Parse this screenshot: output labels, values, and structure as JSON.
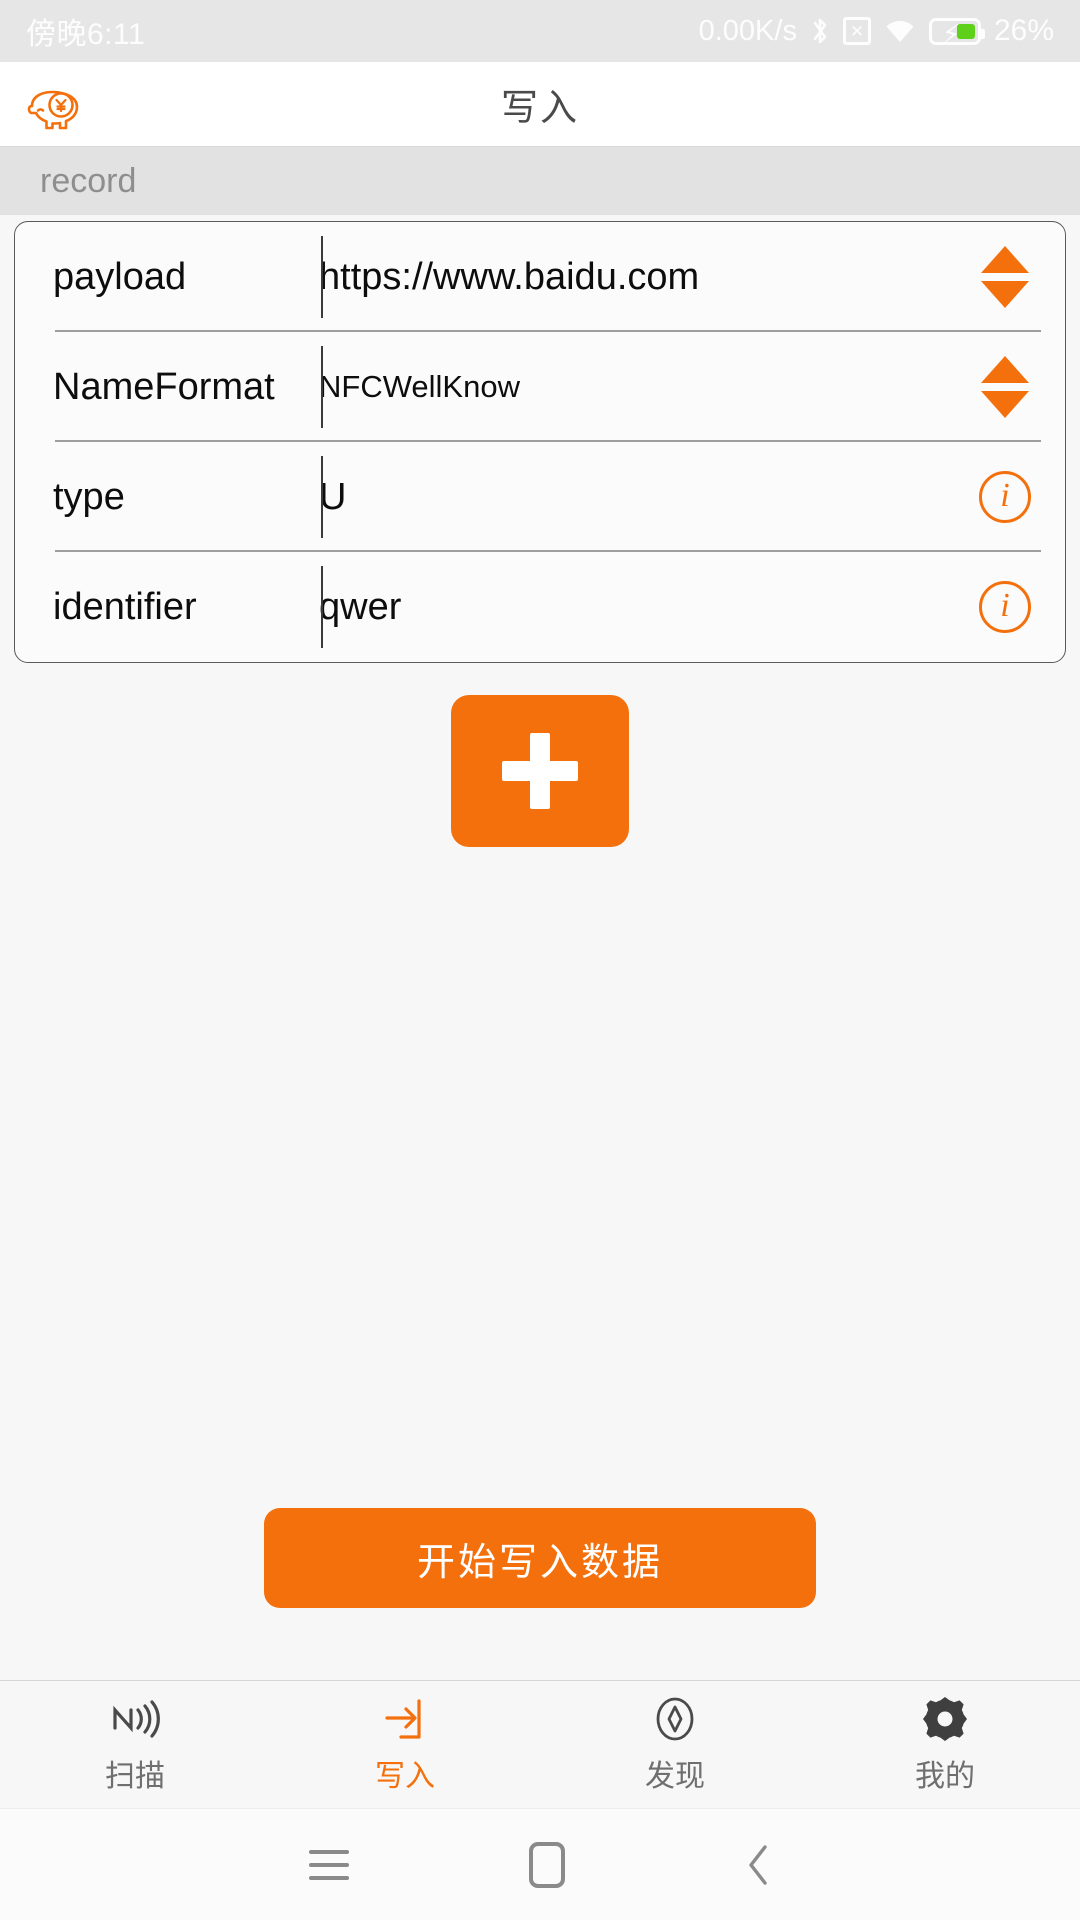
{
  "status_bar": {
    "time": "傍晚6:11",
    "network_speed": "0.00K/s",
    "battery_percent": "26%",
    "icons": [
      "bluetooth-icon",
      "sim-card-icon",
      "wifi-icon",
      "battery-charging-icon"
    ],
    "battery_color": "#5ed01a",
    "background": "#e6e6e6"
  },
  "app_bar": {
    "logo": "piggy-bank-icon",
    "title": "写入",
    "background": "#ffffff"
  },
  "section": {
    "header": "record"
  },
  "record": {
    "rows": [
      {
        "label": "payload",
        "value": "https://www.baidu.com",
        "value_size": "large",
        "action": "stepper-icon"
      },
      {
        "label": "NameFormat",
        "value": "NFCWellKnow",
        "value_size": "small",
        "action": "stepper-icon"
      },
      {
        "label": "type",
        "value": "U",
        "value_size": "large",
        "action": "info-icon"
      },
      {
        "label": "identifier",
        "value": "qwer",
        "value_size": "large",
        "action": "info-icon"
      }
    ]
  },
  "add_button": {
    "icon": "plus-icon",
    "label": ""
  },
  "primary_action": {
    "label": "开始写入数据",
    "color": "#f4700c"
  },
  "tab_bar": {
    "active_color": "#f4700c",
    "inactive_color": "#6f6f6f",
    "items": [
      {
        "icon": "nfc-icon",
        "label": "扫描",
        "active": false
      },
      {
        "icon": "write-arrow-icon",
        "label": "写入",
        "active": true
      },
      {
        "icon": "compass-icon",
        "label": "发现",
        "active": false
      },
      {
        "icon": "gear-icon",
        "label": "我的",
        "active": false
      }
    ]
  },
  "android_nav": {
    "items": [
      "recents-menu-icon",
      "home-icon",
      "back-icon"
    ]
  }
}
